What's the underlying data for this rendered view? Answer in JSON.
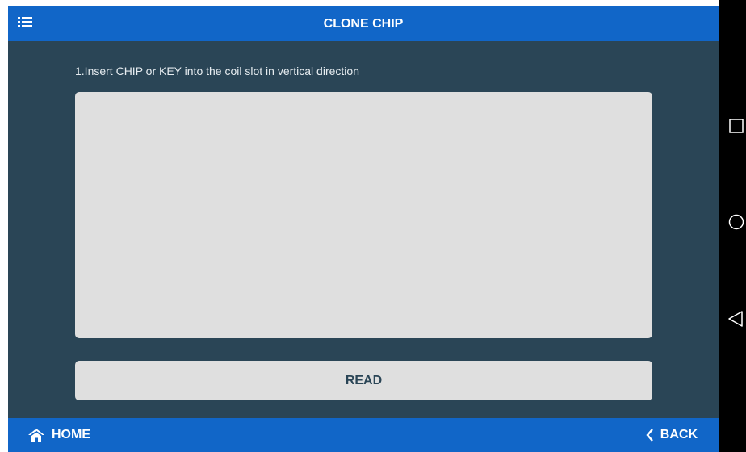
{
  "header": {
    "title": "CLONE CHIP",
    "menu_icon": "list-menu-icon"
  },
  "main": {
    "instruction": "1.Insert CHIP or KEY into the coil slot in vertical direction",
    "read_label": "READ"
  },
  "footer": {
    "home_label": "HOME",
    "home_icon": "home-icon",
    "back_label": "BACK",
    "back_icon": "chevron-left-icon"
  },
  "system_nav": {
    "icons": [
      "recents-square-icon",
      "home-circle-icon",
      "back-triangle-icon"
    ]
  },
  "colors": {
    "bar_blue": "#1166c8",
    "background": "#2a4556",
    "panel_gray": "#dfdfdf"
  }
}
